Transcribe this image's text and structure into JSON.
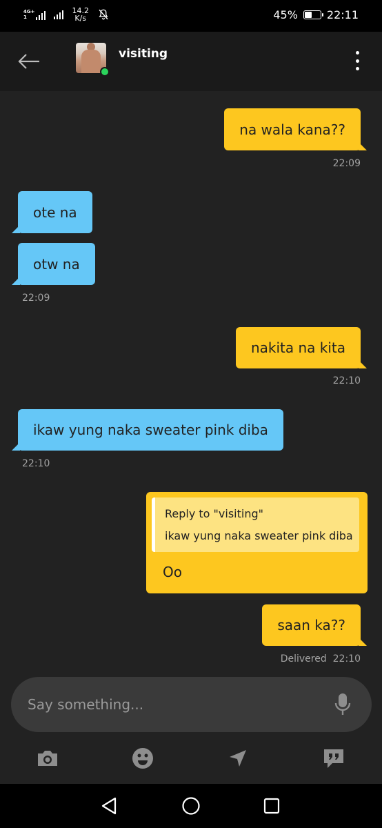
{
  "status_bar": {
    "network_left": "4G+",
    "network_sub": "1",
    "speed_value": "14.2",
    "speed_unit": "K/s",
    "battery": "45%",
    "time": "22:11",
    "battery_level": 0.45
  },
  "header": {
    "contact_name": "visiting",
    "online": true
  },
  "messages": [
    {
      "direction": "out",
      "text": "na wala kana??",
      "time": "22:09"
    },
    {
      "direction": "in",
      "text": "ote na"
    },
    {
      "direction": "in",
      "text": "otw na",
      "time": "22:09"
    },
    {
      "direction": "out",
      "text": "nakita na kita",
      "time": "22:10"
    },
    {
      "direction": "in",
      "text": "ikaw yung naka sweater pink diba",
      "time": "22:10"
    },
    {
      "direction": "out",
      "reply_title": "Reply to \"visiting\"",
      "reply_text": "ikaw yung naka sweater pink diba",
      "text": "Oo"
    },
    {
      "direction": "out",
      "text": "saan ka??",
      "status": "Delivered",
      "time": "22:10"
    }
  ],
  "composer": {
    "placeholder": "Say something..."
  },
  "toolbar_icons": [
    "camera-icon",
    "smiley-icon",
    "location-arrow-icon",
    "saved-phrases-icon",
    "microphone-icon"
  ],
  "colors": {
    "outgoing_bubble": "#fdc71f",
    "incoming_bubble": "#65c7f7",
    "background": "#222222",
    "online_dot": "#2bd45c"
  }
}
